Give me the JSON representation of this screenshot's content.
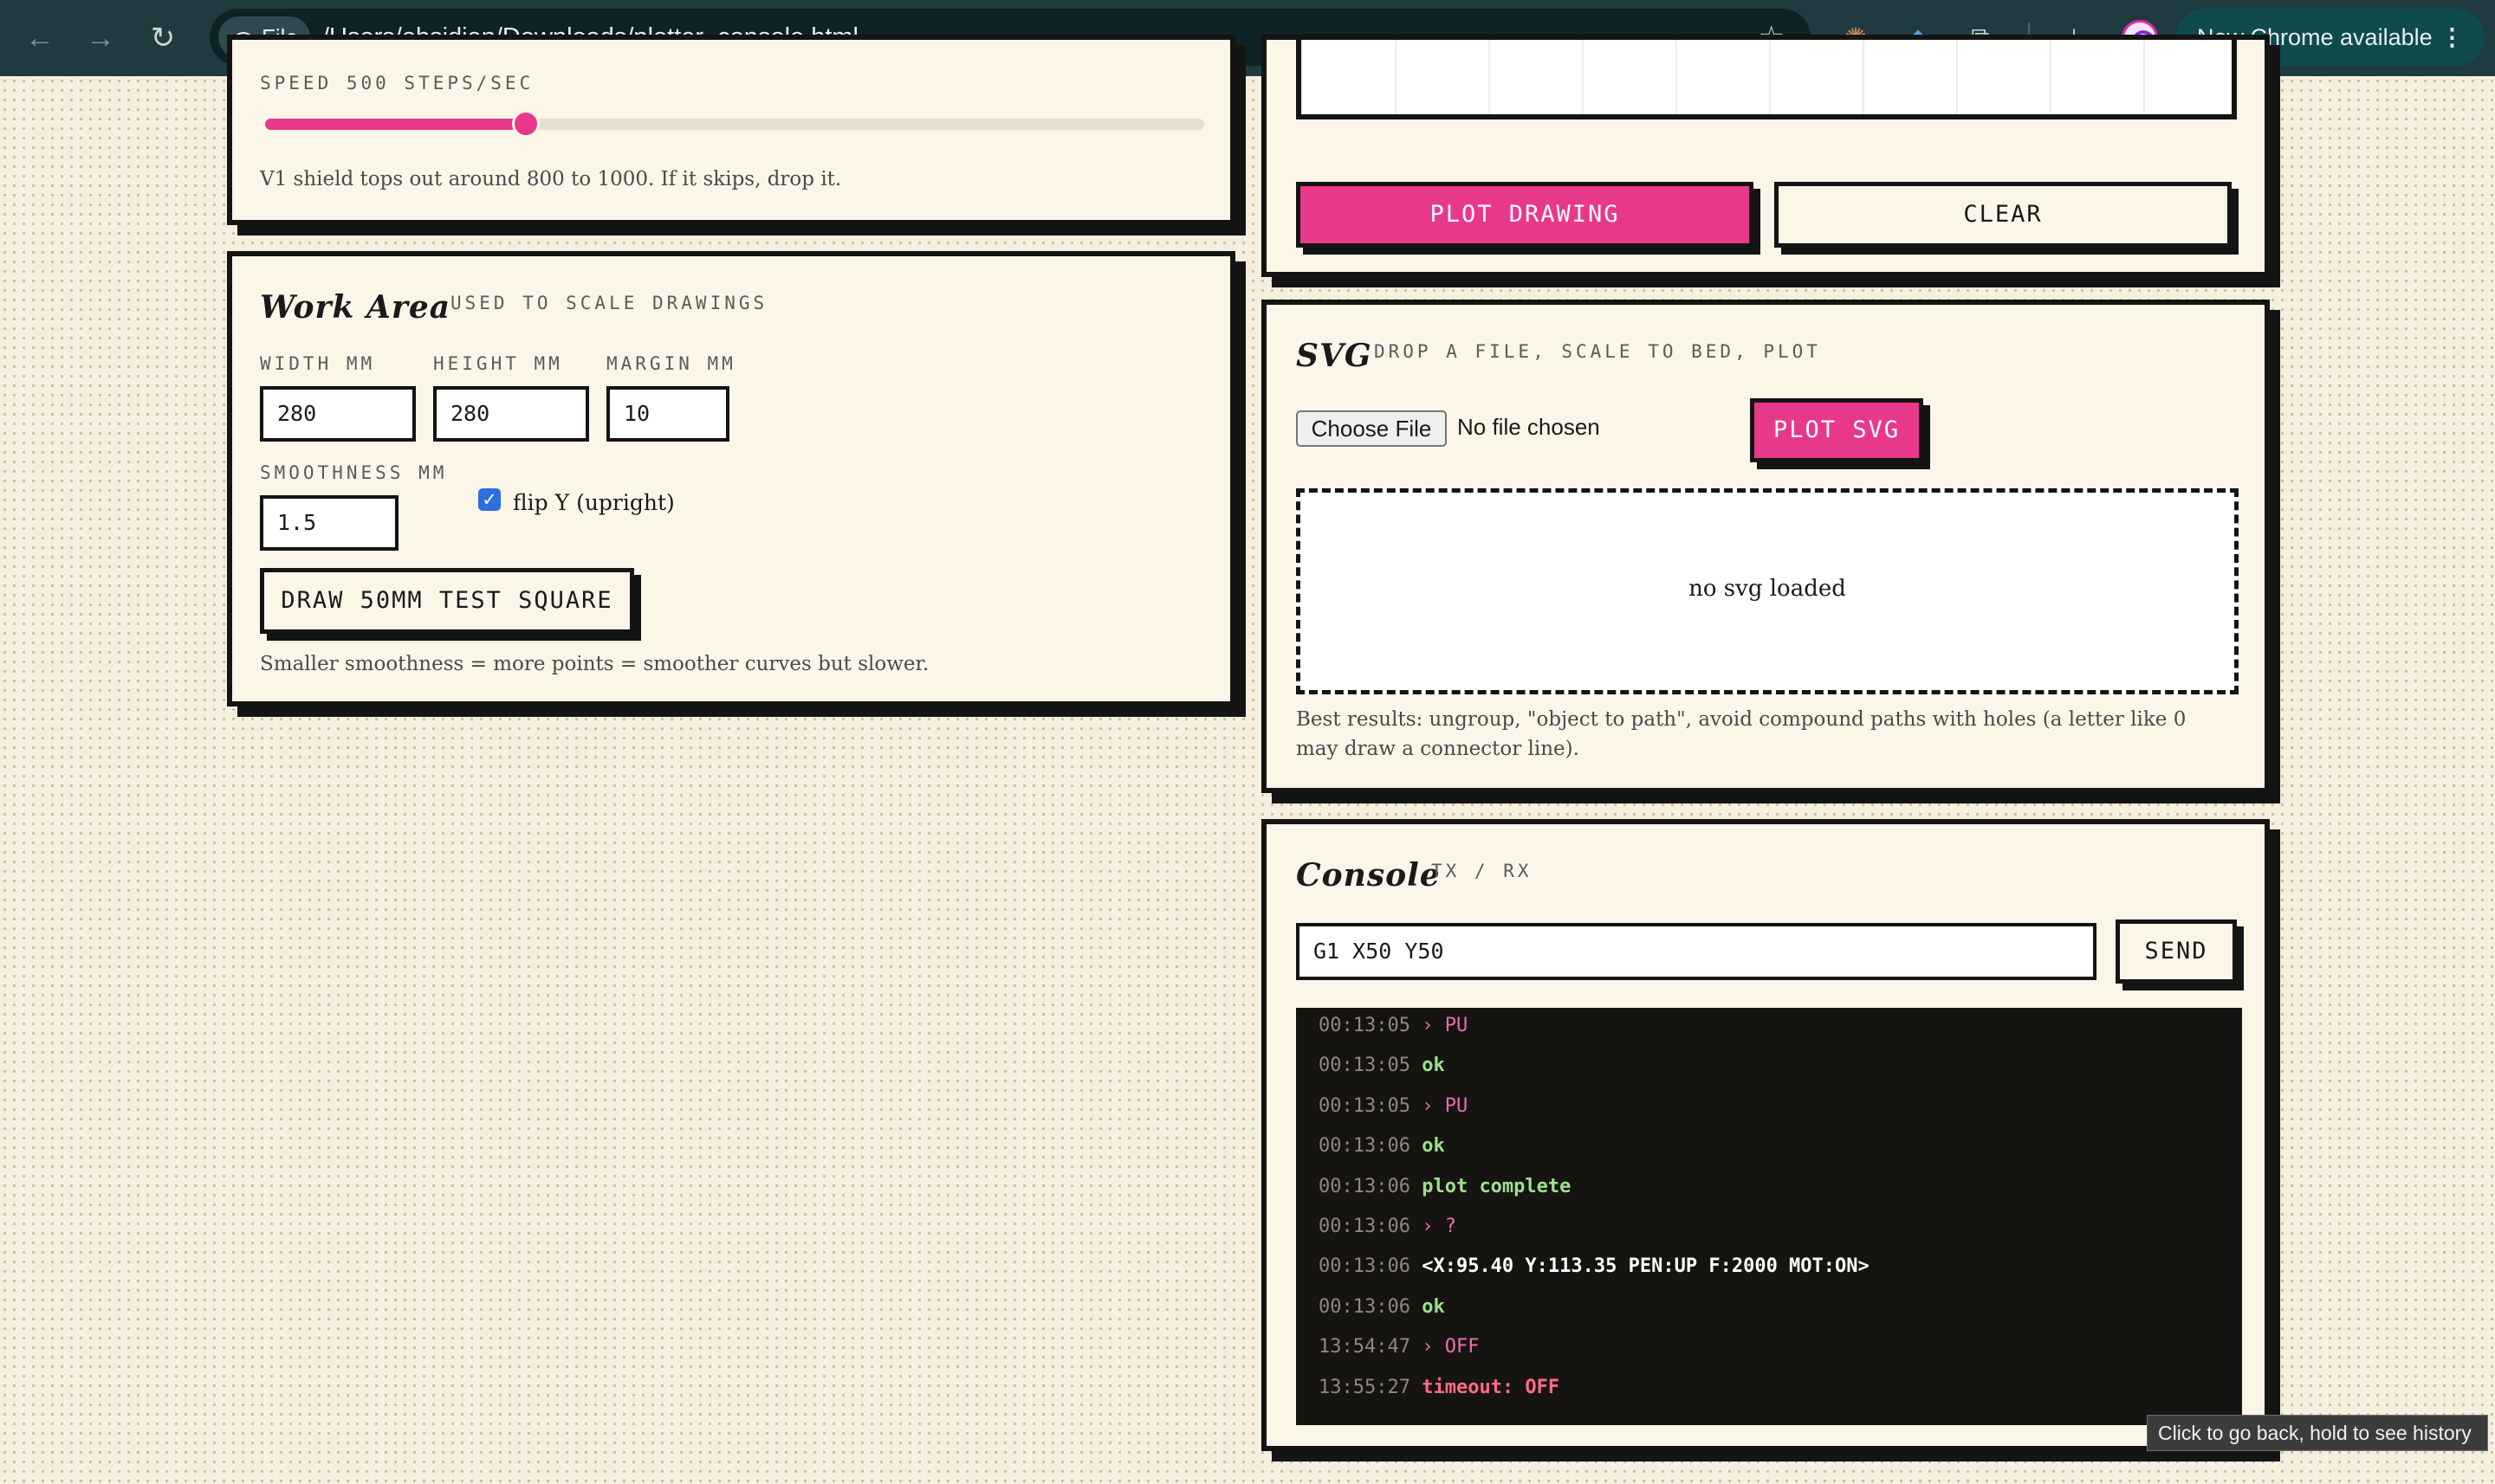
{
  "browser": {
    "chip_label": "File",
    "url": "/Users/obsidian/Downloads/plotter_console.html",
    "update_label": "New Chrome available"
  },
  "speed": {
    "label": "SPEED 500 STEPS/SEC",
    "value": 500,
    "min": 0,
    "max": 1800,
    "note": "V1 shield tops out around 800 to 1000. If it skips, drop it."
  },
  "work_area": {
    "title": "Work Area",
    "subtitle": "USED TO SCALE DRAWINGS",
    "width_label": "WIDTH MM",
    "width_value": "280",
    "height_label": "HEIGHT MM",
    "height_value": "280",
    "margin_label": "MARGIN MM",
    "margin_value": "10",
    "smoothness_label": "SMOOTHNESS MM",
    "smoothness_value": "1.5",
    "flip_label": "flip Y (upright)",
    "flip_checked": true,
    "test_button": "DRAW 50MM TEST SQUARE",
    "note": "Smaller smoothness = more points = smoother curves but slower."
  },
  "drawing": {
    "plot_button": "PLOT DRAWING",
    "clear_button": "CLEAR"
  },
  "svg": {
    "title": "SVG",
    "subtitle": "DROP A FILE, SCALE TO BED, PLOT",
    "choose_button": "Choose File",
    "file_status": "No file chosen",
    "plot_button": "PLOT SVG",
    "preview_text": "no svg loaded",
    "note_line1": "Best results: ungroup, \"object to path\", avoid compound paths with holes (a letter like 0",
    "note_line2": "may draw a connector line)."
  },
  "console": {
    "title": "Console",
    "subtitle": "TX / RX",
    "input_value": "G1 X50 Y50",
    "send_button": "SEND",
    "log": [
      {
        "time": "00:13:05",
        "text": "› PU",
        "kind": "tx"
      },
      {
        "time": "00:13:05",
        "text": "ok",
        "kind": "rx"
      },
      {
        "time": "00:13:05",
        "text": "› PU",
        "kind": "tx"
      },
      {
        "time": "00:13:06",
        "text": "ok",
        "kind": "rx"
      },
      {
        "time": "00:13:06",
        "text": "plot complete",
        "kind": "ev"
      },
      {
        "time": "00:13:06",
        "text": "› ?",
        "kind": "tx"
      },
      {
        "time": "00:13:06",
        "text": "<X:95.40 Y:113.35 PEN:UP F:2000 MOT:ON>",
        "kind": "info"
      },
      {
        "time": "00:13:06",
        "text": "ok",
        "kind": "rx"
      },
      {
        "time": "13:54:47",
        "text": "› OFF",
        "kind": "tx"
      },
      {
        "time": "13:55:27",
        "text": "timeout: OFF",
        "kind": "err"
      }
    ]
  },
  "tooltip": "Click to go back, hold to see history",
  "colors": {
    "accent": "#e8388a",
    "ink": "#141414",
    "paper": "#fbf6e8"
  }
}
